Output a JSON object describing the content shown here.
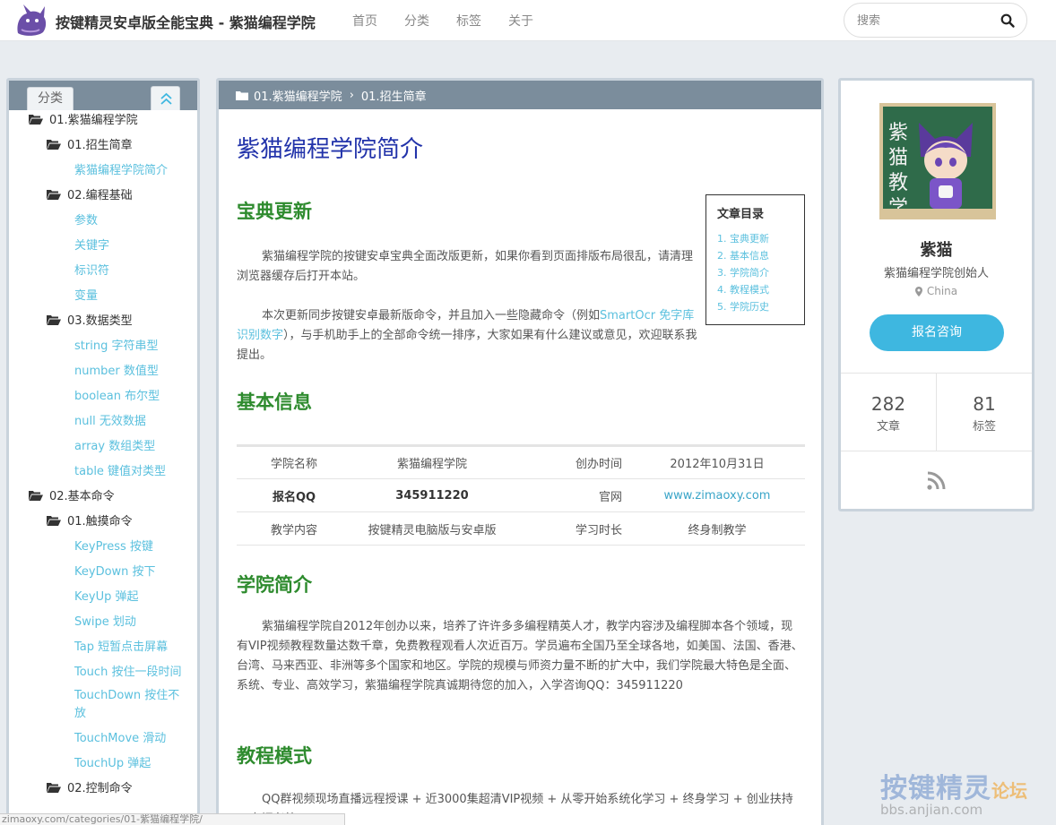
{
  "header": {
    "site_title": "按键精灵安卓版全能宝典 - 紫猫编程学院",
    "nav": [
      "首页",
      "分类",
      "标签",
      "关于"
    ],
    "search_placeholder": "搜索"
  },
  "sidebar": {
    "tab_label": "分类",
    "tree": [
      {
        "type": "folder",
        "level": 0,
        "label": "01.紫猫编程学院"
      },
      {
        "type": "folder",
        "level": 1,
        "label": "01.招生简章"
      },
      {
        "type": "leaf",
        "label": "紫猫编程学院简介"
      },
      {
        "type": "folder",
        "level": 1,
        "label": "02.编程基础"
      },
      {
        "type": "leaf",
        "label": "参数"
      },
      {
        "type": "leaf",
        "label": "关键字"
      },
      {
        "type": "leaf",
        "label": "标识符"
      },
      {
        "type": "leaf",
        "label": "变量"
      },
      {
        "type": "folder",
        "level": 1,
        "label": "03.数据类型"
      },
      {
        "type": "leaf",
        "label": "string 字符串型"
      },
      {
        "type": "leaf",
        "label": "number 数值型"
      },
      {
        "type": "leaf",
        "label": "boolean 布尔型"
      },
      {
        "type": "leaf",
        "label": "null 无效数据"
      },
      {
        "type": "leaf",
        "label": "array 数组类型"
      },
      {
        "type": "leaf",
        "label": "table 键值对类型"
      },
      {
        "type": "folder",
        "level": 0,
        "label": "02.基本命令"
      },
      {
        "type": "folder",
        "level": 1,
        "label": "01.触摸命令"
      },
      {
        "type": "leaf",
        "label": "KeyPress 按键"
      },
      {
        "type": "leaf",
        "label": "KeyDown 按下"
      },
      {
        "type": "leaf",
        "label": "KeyUp 弹起"
      },
      {
        "type": "leaf",
        "label": "Swipe 划动"
      },
      {
        "type": "leaf",
        "label": "Tap 短暂点击屏幕"
      },
      {
        "type": "leaf",
        "label": "Touch 按住一段时间"
      },
      {
        "type": "leaf",
        "label": "TouchDown 按住不放"
      },
      {
        "type": "leaf",
        "label": "TouchMove 滑动"
      },
      {
        "type": "leaf",
        "label": "TouchUp 弹起"
      },
      {
        "type": "folder",
        "level": 1,
        "label": "02.控制命令"
      }
    ]
  },
  "breadcrumb": {
    "part1": "01.紫猫编程学院",
    "sep": "›",
    "part2": "01.招生简章"
  },
  "article": {
    "title": "紫猫编程学院简介",
    "section1_title": "宝典更新",
    "section1_p1": "紫猫编程学院的按键安卓宝典全面改版更新，如果你看到页面排版布局很乱，请清理浏览器缓存后打开本站。",
    "section1_p2_before": "本次更新同步按键安卓最新版命令，并且加入一些隐藏命令（例如",
    "section1_p2_link": "SmartOcr 免字库识别数字",
    "section1_p2_after": "），与手机助手上的全部命令统一排序，大家如果有什么建议或意见，欢迎联系我提出。",
    "section2_title": "基本信息",
    "table": [
      [
        "学院名称",
        "紫猫编程学院",
        "创办时间",
        "2012年10月31日"
      ],
      [
        "报名QQ",
        "345911220",
        "官网",
        "www.zimaoxy.com"
      ],
      [
        "教学内容",
        "按键精灵电脑版与安卓版",
        "学习时长",
        "终身制教学"
      ]
    ],
    "section3_title": "学院简介",
    "section3_p": "紫猫编程学院自2012年创办以来，培养了许许多多编程精英人才，教学内容涉及编程脚本各个领域，现有VIP视频教程数量达数千章，免费教程观看人次近百万。学员遍布全国乃至全球各地，如美国、法国、香港、台湾、马来西亚、非洲等多个国家和地区。学院的规模与师资力量不断的扩大中，我们学院最大特色是全面、系统、专业、高效学习，紫猫编程学院真诚期待您的加入，入学咨询QQ：345911220",
    "section4_title": "教程模式",
    "section4_p": "QQ群视频现场直播远程授课 + 近3000集超清VIP视频 + 从零开始系统化学习 + 终身学习 + 创业扶持 + 有问必答"
  },
  "toc": {
    "title": "文章目录",
    "items": [
      "1. 宝典更新",
      "2. 基本信息",
      "3. 学院简介",
      "4. 教程模式",
      "5. 学院历史"
    ]
  },
  "profile": {
    "name": "紫猫",
    "role": "紫猫编程学院创始人",
    "location": "China",
    "button": "报名咨询",
    "stats": [
      {
        "num": "282",
        "label": "文章"
      },
      {
        "num": "81",
        "label": "标签"
      }
    ]
  },
  "status_bar": "zimaoxy.com/categories/01-紫猫编程学院/",
  "watermark": {
    "brand": "按键精灵",
    "forum": "论坛",
    "url": "bbs.anjian.com"
  },
  "colors": {
    "accent": "#3eb7e0",
    "link": "#5bc0de",
    "heading": "#2e8b2e",
    "title": "#2233aa",
    "panel_header": "#7b8d9c"
  }
}
